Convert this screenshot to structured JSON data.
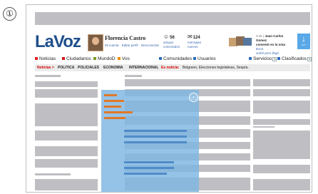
{
  "step_marker": "①",
  "brand": {
    "logo": "LaVoz"
  },
  "user": {
    "name": "Florencia Castro",
    "links": [
      "Mi cuenta",
      "Editar perfil",
      "Desconectar"
    ]
  },
  "counters": [
    {
      "icon": "☺",
      "value": "56",
      "label_1": "amigos",
      "label_2": "conectados"
    },
    {
      "icon": "✉",
      "value": "124",
      "label_1": "mensajes",
      "label_2": "nuevos"
    }
  ],
  "notification": {
    "time": "3:45 |",
    "author": "Juan Carlos Gomez",
    "text_pre": "comentó en la nota",
    "link": "Boca",
    "headline": "sufrió pero llegó"
  },
  "update_button": {
    "icon": "↓",
    "label": "ACT"
  },
  "nav": [
    {
      "label": "Noticias",
      "color": "#e02020"
    },
    {
      "label": "Ciudadanos",
      "color": "#d81818"
    },
    {
      "label": "MundoD",
      "color": "#7a9a1a"
    },
    {
      "label": "Vos",
      "color": "#f08a00"
    },
    {
      "label": "Comunidades",
      "color": "#2b6cc4"
    },
    {
      "label": "Usuarios",
      "color": "#2b6cc4"
    },
    {
      "label": "Servicios",
      "color": "#2b6cc4"
    },
    {
      "label": "Clasificados",
      "color": "#2b6cc4"
    }
  ],
  "subnav": {
    "section": "Noticias >",
    "items": [
      "POLITICA",
      "POLICIALES",
      "ECONOMIA",
      "INTERNACIONAL"
    ],
    "news_label": "Es noticia:",
    "news_text": "Belgrano, Elecciones legislativas, Sequía."
  },
  "overlay": {
    "close_icon": "ⓧ"
  }
}
